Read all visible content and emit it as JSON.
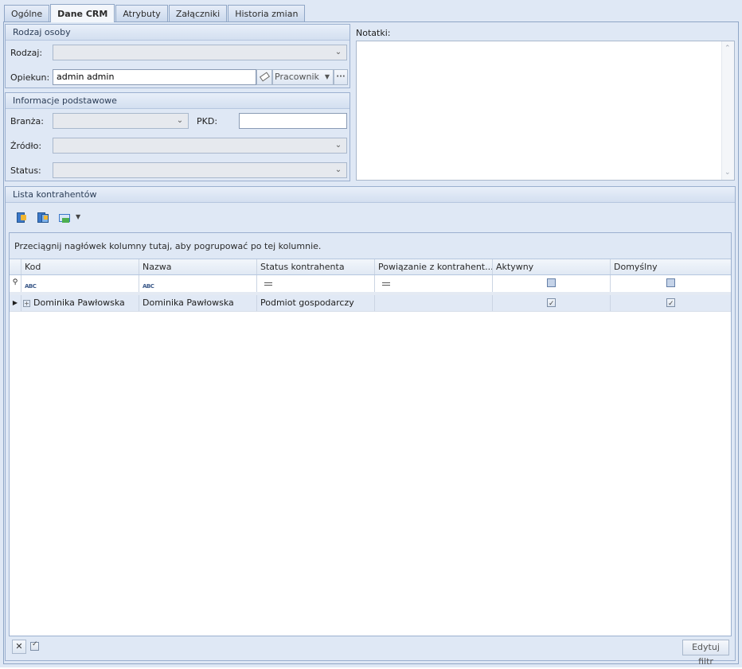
{
  "tabs": [
    "Ogólne",
    "Dane CRM",
    "Atrybuty",
    "Załączniki",
    "Historia zmian"
  ],
  "rodzaj_osoby": {
    "title": "Rodzaj osoby",
    "rodzaj_label": "Rodzaj:",
    "rodzaj_value": "",
    "opiekun_label": "Opiekun:",
    "opiekun_value": "admin admin",
    "opiekun_type": "Pracownik",
    "more_label": "···"
  },
  "informacje": {
    "title": "Informacje podstawowe",
    "branza_label": "Branża:",
    "pkd_label": "PKD:",
    "pkd_value": "",
    "zrodlo_label": "Źródło:",
    "status_label": "Status:"
  },
  "notatki": {
    "label": "Notatki:",
    "value": ""
  },
  "lista": {
    "title": "Lista kontrahentów",
    "group_hint": "Przeciągnij nagłówek kolumny tutaj, aby pogrupować po tej kolumnie.",
    "columns": [
      "Kod",
      "Nazwa",
      "Status kontrahenta",
      "Powiązanie z kontrahent...",
      "Aktywny",
      "Domyślny"
    ],
    "filter_abc": "ABC",
    "rows": [
      {
        "kod": "Dominika Pawłowska",
        "nazwa": "Dominika Pawłowska",
        "status": "Podmiot gospodarczy",
        "powiazanie": "",
        "aktywny": true,
        "domyslny": true
      }
    ],
    "edit_filter_label": "Edytuj filtr"
  },
  "colors": {
    "background": "#dfe8f5",
    "border": "#9bb0cf",
    "row_highlight": "#e1e9f5"
  }
}
